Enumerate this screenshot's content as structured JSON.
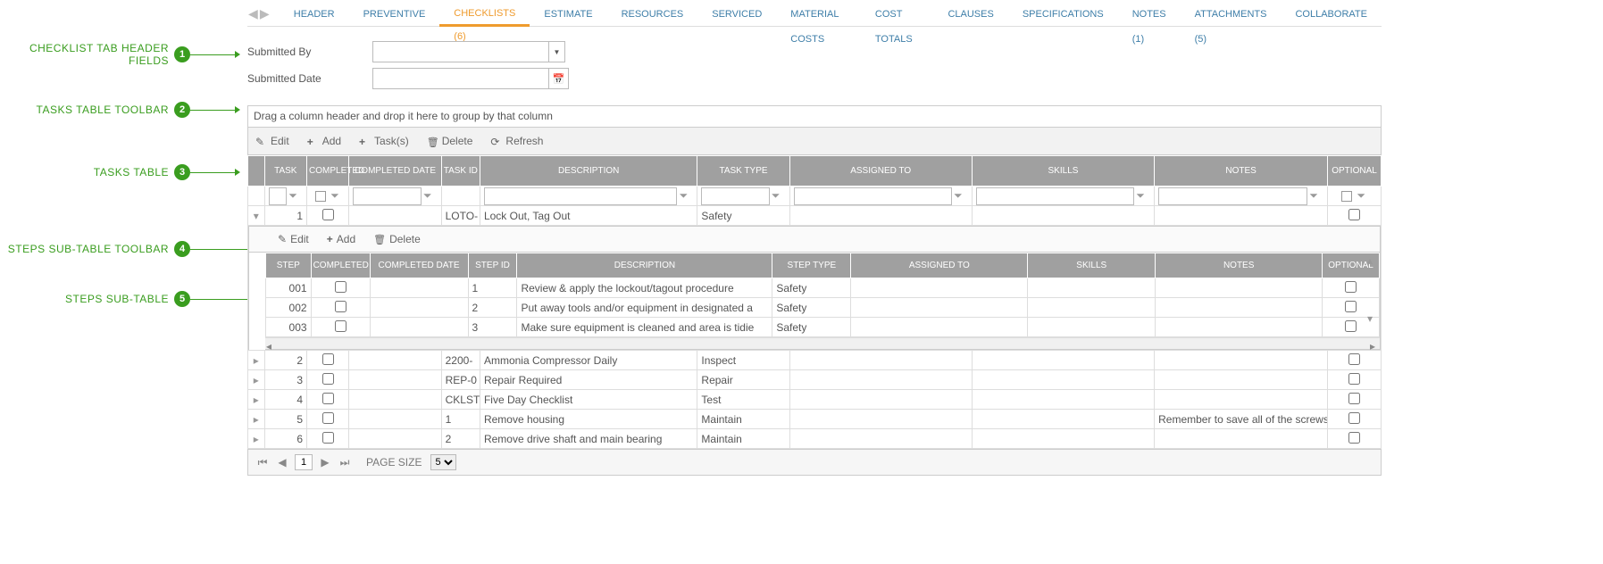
{
  "callouts": [
    {
      "label": "CHECKLIST TAB HEADER FIELDS",
      "num": "1"
    },
    {
      "label": "TASKS TABLE TOOLBAR",
      "num": "2"
    },
    {
      "label": "TASKS TABLE",
      "num": "3"
    },
    {
      "label": "STEPS SUB-TABLE TOOLBAR",
      "num": "4"
    },
    {
      "label": "STEPS SUB-TABLE",
      "num": "5"
    }
  ],
  "tabs": [
    {
      "label": "HEADER"
    },
    {
      "label": "PREVENTIVE"
    },
    {
      "label": "CHECKLISTS (6)"
    },
    {
      "label": "ESTIMATE"
    },
    {
      "label": "RESOURCES"
    },
    {
      "label": "SERVICED"
    },
    {
      "label": "MATERIAL COSTS"
    },
    {
      "label": "COST TOTALS"
    },
    {
      "label": "CLAUSES"
    },
    {
      "label": "SPECIFICATIONS"
    },
    {
      "label": "NOTES (1)"
    },
    {
      "label": "ATTACHMENTS (5)"
    },
    {
      "label": "COLLABORATE"
    }
  ],
  "activeTabIndex": 2,
  "header": {
    "submitted_by_label": "Submitted By",
    "submitted_by_value": "",
    "submitted_date_label": "Submitted Date",
    "submitted_date_value": ""
  },
  "group_bar": "Drag a column header and drop it here to group by that column",
  "tasks_toolbar": {
    "edit": "Edit",
    "add": "Add",
    "tasks": "Task(s)",
    "delete": "Delete",
    "refresh": "Refresh"
  },
  "tasks_columns": [
    "",
    "TASK",
    "COMPLETED",
    "COMPLETED DATE",
    "TASK ID",
    "DESCRIPTION",
    "TASK TYPE",
    "ASSIGNED TO",
    "SKILLS",
    "NOTES",
    "OPTIONAL"
  ],
  "tasks": [
    {
      "expanded": true,
      "task": "1",
      "completed": false,
      "completed_date": "",
      "task_id": "LOTO-",
      "description": "Lock Out, Tag Out",
      "task_type": "Safety",
      "assigned_to": "",
      "skills": "",
      "notes": "",
      "optional": false
    },
    {
      "expanded": false,
      "task": "2",
      "completed": false,
      "completed_date": "",
      "task_id": "2200-",
      "description": "Ammonia Compressor Daily",
      "task_type": "Inspect",
      "assigned_to": "",
      "skills": "",
      "notes": "",
      "optional": false
    },
    {
      "expanded": false,
      "task": "3",
      "completed": false,
      "completed_date": "",
      "task_id": "REP-0",
      "description": "Repair Required",
      "task_type": "Repair",
      "assigned_to": "",
      "skills": "",
      "notes": "",
      "optional": false
    },
    {
      "expanded": false,
      "task": "4",
      "completed": false,
      "completed_date": "",
      "task_id": "CKLST",
      "description": "Five Day Checklist",
      "task_type": "Test",
      "assigned_to": "",
      "skills": "",
      "notes": "",
      "optional": false
    },
    {
      "expanded": false,
      "task": "5",
      "completed": false,
      "completed_date": "",
      "task_id": "1",
      "description": "Remove housing",
      "task_type": "Maintain",
      "assigned_to": "",
      "skills": "",
      "notes": "Remember to save all of the screws",
      "optional": false
    },
    {
      "expanded": false,
      "task": "6",
      "completed": false,
      "completed_date": "",
      "task_id": "2",
      "description": "Remove drive shaft and main bearing",
      "task_type": "Maintain",
      "assigned_to": "",
      "skills": "",
      "notes": "",
      "optional": false
    }
  ],
  "steps_toolbar": {
    "edit": "Edit",
    "add": "Add",
    "delete": "Delete"
  },
  "steps_columns": [
    "STEP",
    "COMPLETED",
    "COMPLETED DATE",
    "STEP ID",
    "DESCRIPTION",
    "STEP TYPE",
    "ASSIGNED TO",
    "SKILLS",
    "NOTES",
    "OPTIONAL"
  ],
  "steps": [
    {
      "step": "001",
      "completed": false,
      "completed_date": "",
      "step_id": "1",
      "description": "Review & apply the lockout/tagout procedure",
      "step_type": "Safety",
      "assigned_to": "",
      "skills": "",
      "notes": "",
      "optional": false
    },
    {
      "step": "002",
      "completed": false,
      "completed_date": "",
      "step_id": "2",
      "description": "Put away tools and/or equipment in designated a",
      "step_type": "Safety",
      "assigned_to": "",
      "skills": "",
      "notes": "",
      "optional": false
    },
    {
      "step": "003",
      "completed": false,
      "completed_date": "",
      "step_id": "3",
      "description": "Make sure equipment is cleaned and area is tidie",
      "step_type": "Safety",
      "assigned_to": "",
      "skills": "",
      "notes": "",
      "optional": false
    }
  ],
  "pager": {
    "page": "1",
    "page_size_label": "PAGE SIZE",
    "page_size_value": "5"
  }
}
